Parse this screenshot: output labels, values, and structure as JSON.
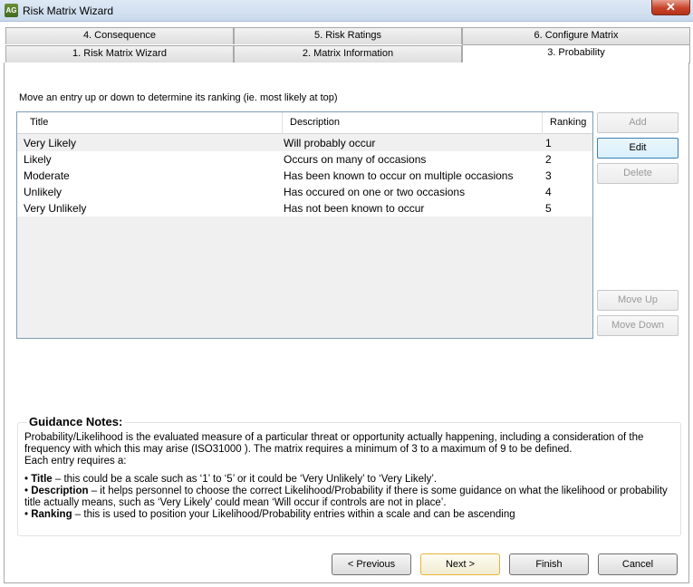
{
  "window": {
    "title": "Risk Matrix Wizard",
    "app_icon_text": "AG",
    "close_glyph": "✕"
  },
  "tabs": {
    "row_back": [
      "4. Consequence",
      "5. Risk Ratings",
      "6. Configure Matrix"
    ],
    "row_front": [
      "1. Risk Matrix Wizard",
      "2. Matrix Information",
      "3. Probability"
    ],
    "active": "3. Probability"
  },
  "instruction": "Move an entry up or down to determine its ranking (ie. most likely at top)",
  "grid": {
    "columns": [
      "Title",
      "Description",
      "Ranking"
    ],
    "rows": [
      {
        "title": "Very Likely",
        "description": "Will probably occur",
        "ranking": "1"
      },
      {
        "title": "Likely",
        "description": "Occurs on many of occasions",
        "ranking": "2"
      },
      {
        "title": "Moderate",
        "description": "Has been known to occur on multiple occasions",
        "ranking": "3"
      },
      {
        "title": "Unlikely",
        "description": "Has occured on one or two occasions",
        "ranking": "4"
      },
      {
        "title": "Very Unlikely",
        "description": "Has not been known to occur",
        "ranking": "5"
      }
    ],
    "selected_row": "Very Likely"
  },
  "side_buttons": {
    "add": "Add",
    "edit": "Edit",
    "delete": "Delete",
    "move_up": "Move Up",
    "move_down": "Move Down"
  },
  "guidance": {
    "heading": "Guidance Notes:",
    "para1": "Probability/Likelihood is the evaluated measure of a particular threat or opportunity actually happening, including a consideration of the frequency with which this may arise (ISO31000 ). The matrix requires a minimum of 3 to a maximum of 9 to be defined.",
    "para2": "Each entry requires a:",
    "bullet_title_label": "Title",
    "bullet_title_text": " – this could be a scale such as ‘1’ to ‘5’ or it could be ‘Very Unlikely’ to ‘Very Likely’.",
    "bullet_desc_label": "Description",
    "bullet_desc_text": " – it helps personnel to choose the correct Likelihood/Probability if there is some guidance on what the likelihood or probability title actually means, such as ‘Very Likely’ could mean ‘Will occur if controls are not in place’.",
    "bullet_rank_label": "Ranking",
    "bullet_rank_text": " – this is used to position your Likelihood/Probability entries within a scale and can be ascending"
  },
  "footer": {
    "previous": "< Previous",
    "next": "Next >",
    "finish": "Finish",
    "cancel": "Cancel"
  },
  "colors": {
    "titlebar": "#c9d9ec",
    "close": "#c8442b",
    "grid_border": "#7f9db9",
    "default_button_border": "#e8b43a"
  }
}
